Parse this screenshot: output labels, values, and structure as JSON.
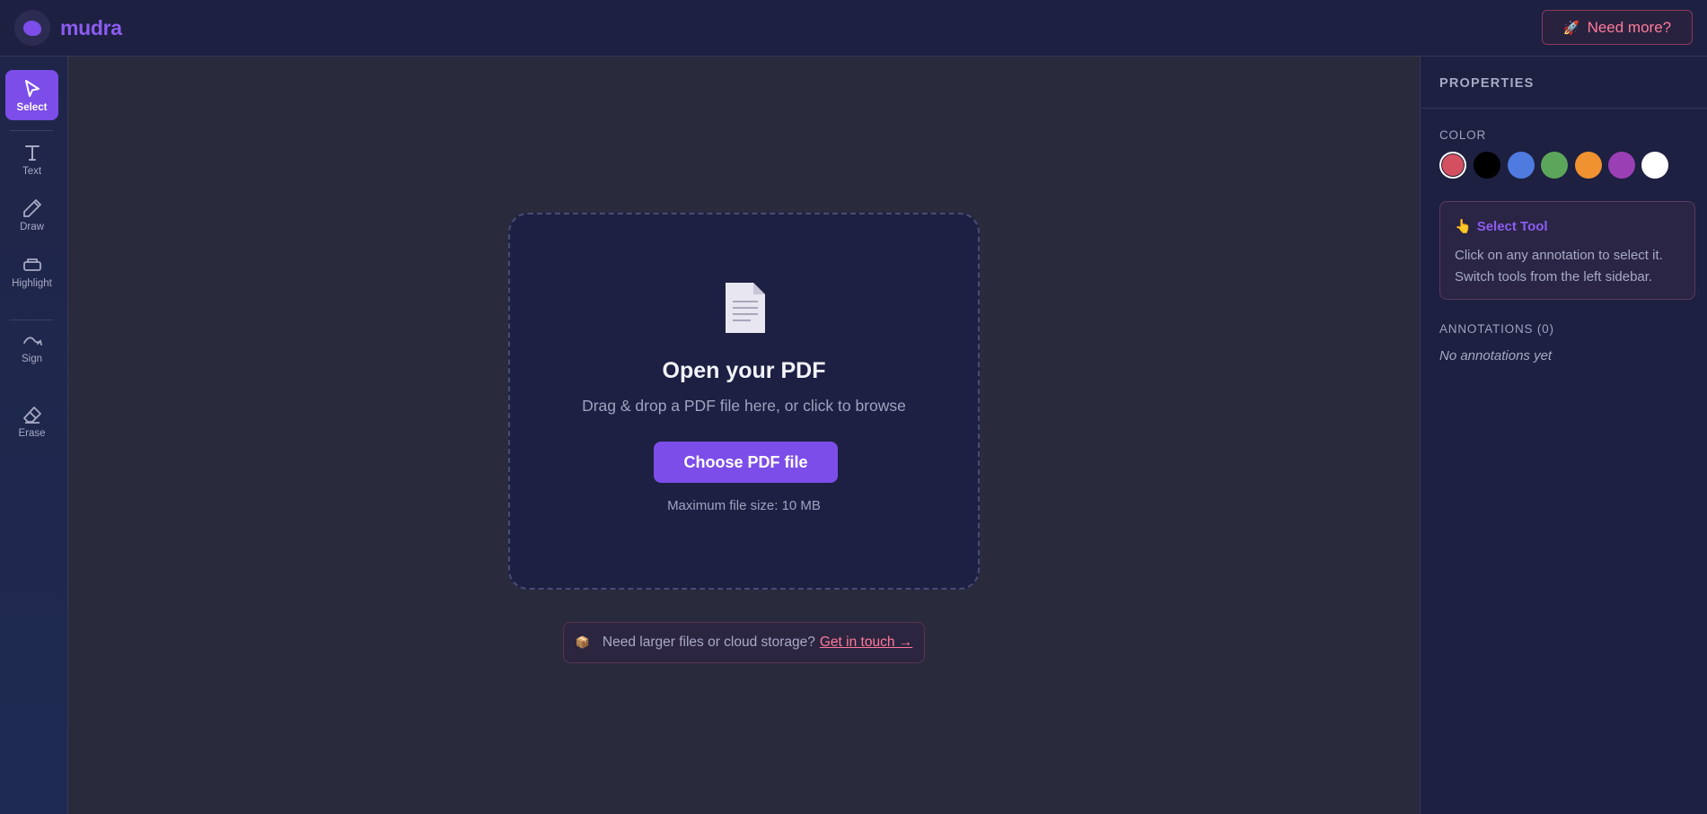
{
  "header": {
    "brand": "mudra",
    "need_more_label": "Need more?"
  },
  "sidebar": {
    "tools": [
      {
        "label": "Select",
        "icon": "cursor-icon",
        "active": true
      },
      {
        "label": "Text",
        "icon": "text-icon",
        "active": false
      },
      {
        "label": "Draw",
        "icon": "pen-icon",
        "active": false
      },
      {
        "label": "Highlight",
        "icon": "highlighter-icon",
        "active": false
      },
      {
        "label": "Sign",
        "icon": "signature-icon",
        "active": false
      },
      {
        "label": "Erase",
        "icon": "eraser-icon",
        "active": false
      }
    ]
  },
  "dropzone": {
    "title": "Open your PDF",
    "subtitle": "Drag & drop a PDF file here, or click to browse",
    "button_label": "Choose PDF file",
    "max_size": "Maximum file size: 10 MB"
  },
  "contact": {
    "text": "Need larger files or cloud storage?",
    "link": "Get in touch →"
  },
  "properties": {
    "title": "PROPERTIES",
    "color_label": "COLOR",
    "colors": [
      "#d45060",
      "#000000",
      "#4f7be0",
      "#5ca65c",
      "#f0922f",
      "#9b3fb5",
      "#ffffff"
    ],
    "selected_color": "#d45060",
    "tool_title": "Select Tool",
    "tool_description": "Click on any annotation to select it. Switch tools from the left sidebar.",
    "annotations_label": "ANNOTATIONS (0)",
    "annotations_empty": "No annotations yet"
  },
  "theme": {
    "accent": "#7c4de8",
    "link": "#ff7a99"
  }
}
